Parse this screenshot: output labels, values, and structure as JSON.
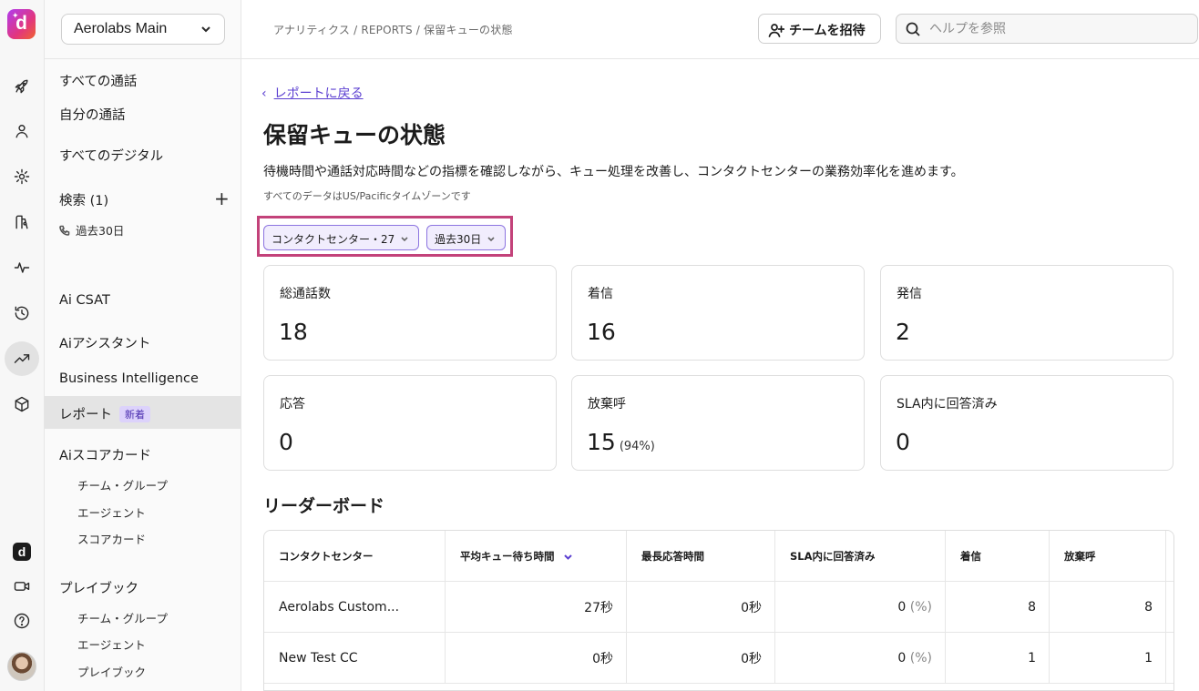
{
  "brand": {
    "logo_letter": "d",
    "accent": "#5b3fd1",
    "highlight_border": "#c3427a"
  },
  "rail": {
    "icons": [
      "rocket-icon",
      "person-icon",
      "gear-icon",
      "route-icon",
      "activity-icon",
      "history-icon",
      "trending-up-icon",
      "cube-icon",
      "dialpad-icon",
      "video-icon",
      "help-icon",
      "avatar"
    ]
  },
  "sidebar": {
    "workspace": "Aerolabs Main",
    "items": {
      "all_calls": "すべての通話",
      "my_calls": "自分の通話",
      "all_digital": "すべてのデジタル",
      "search": "検索 (1)",
      "search_item": "過去30日",
      "ai_csat": "Ai CSAT",
      "ai_assistant": "Aiアシスタント",
      "bi": "Business Intelligence",
      "reports": "レポート",
      "reports_badge": "新着",
      "ai_scorecard": "Aiスコアカード",
      "sc_team_group": "チーム・グループ",
      "sc_agent": "エージェント",
      "sc_scorecard": "スコアカード",
      "playbook": "プレイブック",
      "pb_team_group": "チーム・グループ",
      "pb_agent": "エージェント",
      "pb_playbook": "プレイブック"
    }
  },
  "topbar": {
    "breadcrumb": "アナリティクス / REPORTS / 保留キューの状態",
    "invite_label": "チームを招待",
    "search_placeholder": "ヘルプを参照"
  },
  "main": {
    "back_label": "レポートに戻る",
    "title": "保留キューの状態",
    "description": "待機時間や通話対応時間などの指標を確認しながら、キュー処理を改善し、コンタクトセンターの業務効率化を進めます。",
    "timezone_note": "すべてのデータはUS/Pacificタイムゾーンです",
    "filters": {
      "contact_center": "コンタクトセンター・27",
      "period": "過去30日"
    },
    "cards": [
      {
        "label": "総通話数",
        "value": "18",
        "extra": ""
      },
      {
        "label": "着信",
        "value": "16",
        "extra": ""
      },
      {
        "label": "発信",
        "value": "2",
        "extra": ""
      },
      {
        "label": "応答",
        "value": "0",
        "extra": ""
      },
      {
        "label": "放棄呼",
        "value": "15",
        "extra": "(94%)"
      },
      {
        "label": "SLA内に回答済み",
        "value": "0",
        "extra": ""
      }
    ],
    "leaderboard_title": "リーダーボード",
    "table": {
      "headers": [
        "コンタクトセンター",
        "平均キュー待ち時間",
        "最長応答時間",
        "SLA内に回答済み",
        "着信",
        "放棄呼"
      ],
      "rows": [
        {
          "name": "Aerolabs Custom...",
          "avg_wait": "27秒",
          "longest": "0秒",
          "sla": "0",
          "sla_pct": "(%)",
          "inbound": "8",
          "abandoned": "8"
        },
        {
          "name": "New Test CC",
          "avg_wait": "0秒",
          "longest": "0秒",
          "sla": "0",
          "sla_pct": "(%)",
          "inbound": "1",
          "abandoned": "1"
        }
      ]
    }
  }
}
